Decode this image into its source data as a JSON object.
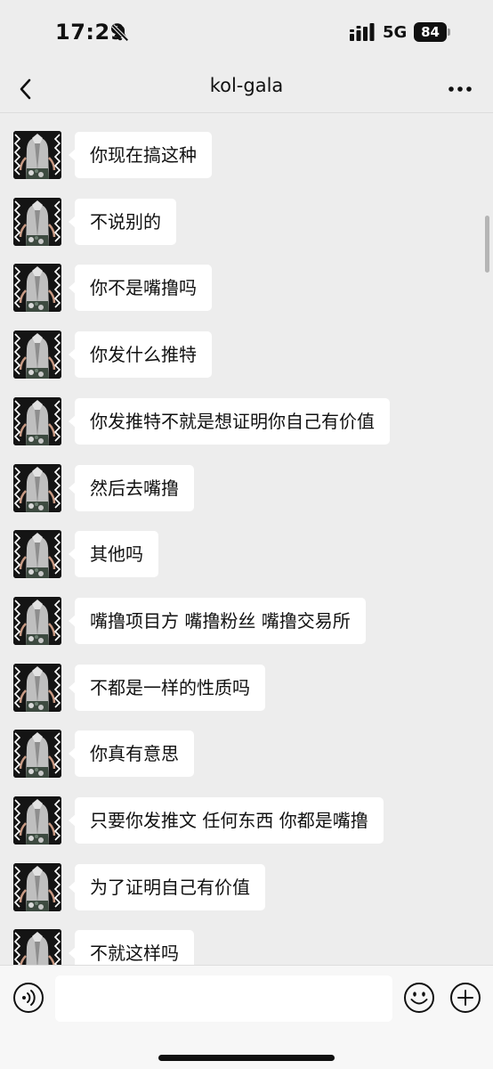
{
  "status_bar": {
    "time": "17:29",
    "network": "5G",
    "battery": "84",
    "icons": [
      "bell-off-icon",
      "signal-icon",
      "battery-icon"
    ]
  },
  "header": {
    "title": "kol-gala",
    "back_icon": "chevron-left-icon",
    "more_icon": "ellipsis-icon"
  },
  "messages": [
    {
      "text": "你现在搞这种"
    },
    {
      "text": "不说别的"
    },
    {
      "text": "你不是嘴撸吗"
    },
    {
      "text": "你发什么推特"
    },
    {
      "text": "你发推特不就是想证明你自己有价值"
    },
    {
      "text": "然后去嘴撸"
    },
    {
      "text": "其他吗"
    },
    {
      "text": "嘴撸项目方 嘴撸粉丝 嘴撸交易所"
    },
    {
      "text": "不都是一样的性质吗"
    },
    {
      "text": "你真有意思"
    },
    {
      "text": "只要你发推文 任何东西 你都是嘴撸"
    },
    {
      "text": "为了证明自己有价值"
    },
    {
      "text": "不就这样吗"
    }
  ],
  "input_bar": {
    "value": "",
    "placeholder": "",
    "icons": [
      "voice-icon",
      "emoji-icon",
      "plus-icon"
    ]
  },
  "colors": {
    "background": "#EDEDED",
    "bubble": "#FFFFFF",
    "input_bar": "#F7F7F7",
    "text": "#111111"
  }
}
